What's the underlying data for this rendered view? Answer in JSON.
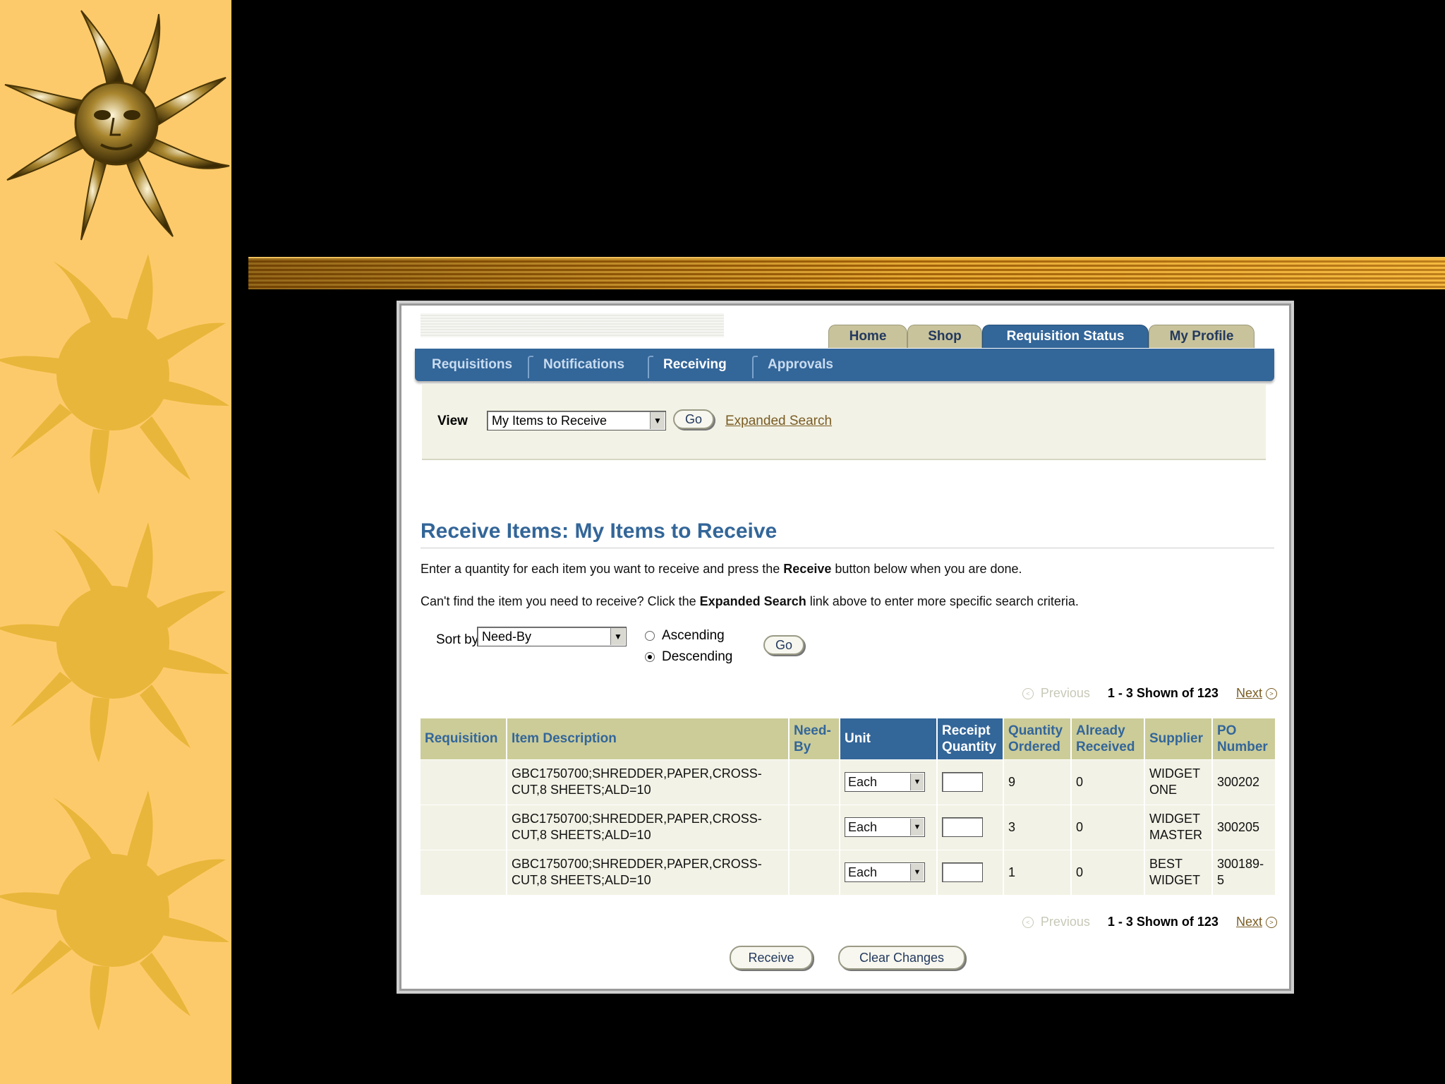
{
  "tabs": [
    "Home",
    "Shop",
    "Requisition Status",
    "My Profile"
  ],
  "subtabs": [
    "Requisitions",
    "Notifications",
    "Receiving",
    "Approvals"
  ],
  "view": {
    "label": "View",
    "selected": "My Items to Receive",
    "go_label": "Go",
    "expanded_search_label": "Expanded Search"
  },
  "page": {
    "title": "Receive Items:  My Items to Receive",
    "instr1_a": "Enter a quantity for each item you want to receive and press the ",
    "instr1_b": "Receive",
    "instr1_c": " button below when you are done.",
    "instr2_a": "Can't find the item you need to receive? Click the ",
    "instr2_b": "Expanded Search",
    "instr2_c": " link above to enter more specific search criteria."
  },
  "sort": {
    "label": "Sort by",
    "selected": "Need-By",
    "ascending_label": "Ascending",
    "descending_label": "Descending",
    "go_label": "Go"
  },
  "pager": {
    "previous_label": "Previous",
    "shown_text": "1 - 3 Shown of 123",
    "next_label": "Next"
  },
  "table": {
    "headers": [
      "Requisition",
      "Item Description",
      "Need-By",
      "Unit",
      "Receipt Quantity",
      "Quantity Ordered",
      "Already Received",
      "Supplier",
      "PO Number"
    ],
    "rows": [
      {
        "requisition": "",
        "item": "GBC1750700;SHREDDER,PAPER,CROSS-CUT,8 SHEETS;ALD=10",
        "need_by": "",
        "unit": "Each",
        "receipt_qty": "",
        "qty_ordered": "9",
        "already_received": "0",
        "supplier": "WIDGET ONE",
        "po": "300202"
      },
      {
        "requisition": "",
        "item": "GBC1750700;SHREDDER,PAPER,CROSS-CUT,8 SHEETS;ALD=10",
        "need_by": "",
        "unit": "Each",
        "receipt_qty": "",
        "qty_ordered": "3",
        "already_received": "0",
        "supplier": "WIDGET MASTER",
        "po": "300205"
      },
      {
        "requisition": "",
        "item": "GBC1750700;SHREDDER,PAPER,CROSS-CUT,8 SHEETS;ALD=10",
        "need_by": "",
        "unit": "Each",
        "receipt_qty": "",
        "qty_ordered": "1",
        "already_received": "0",
        "supplier": "BEST WIDGET",
        "po": "300189-5"
      }
    ]
  },
  "buttons": {
    "receive_label": "Receive",
    "clear_label": "Clear Changes"
  },
  "colors": {
    "brand_blue": "#336699",
    "header_tan": "#cccc99",
    "slide_strip": "#fdca6b",
    "sun_outline": "#e8b63a"
  },
  "decoration_icons": [
    "metal-sun-icon",
    "sun-icon",
    "sun-icon",
    "sun-icon"
  ]
}
